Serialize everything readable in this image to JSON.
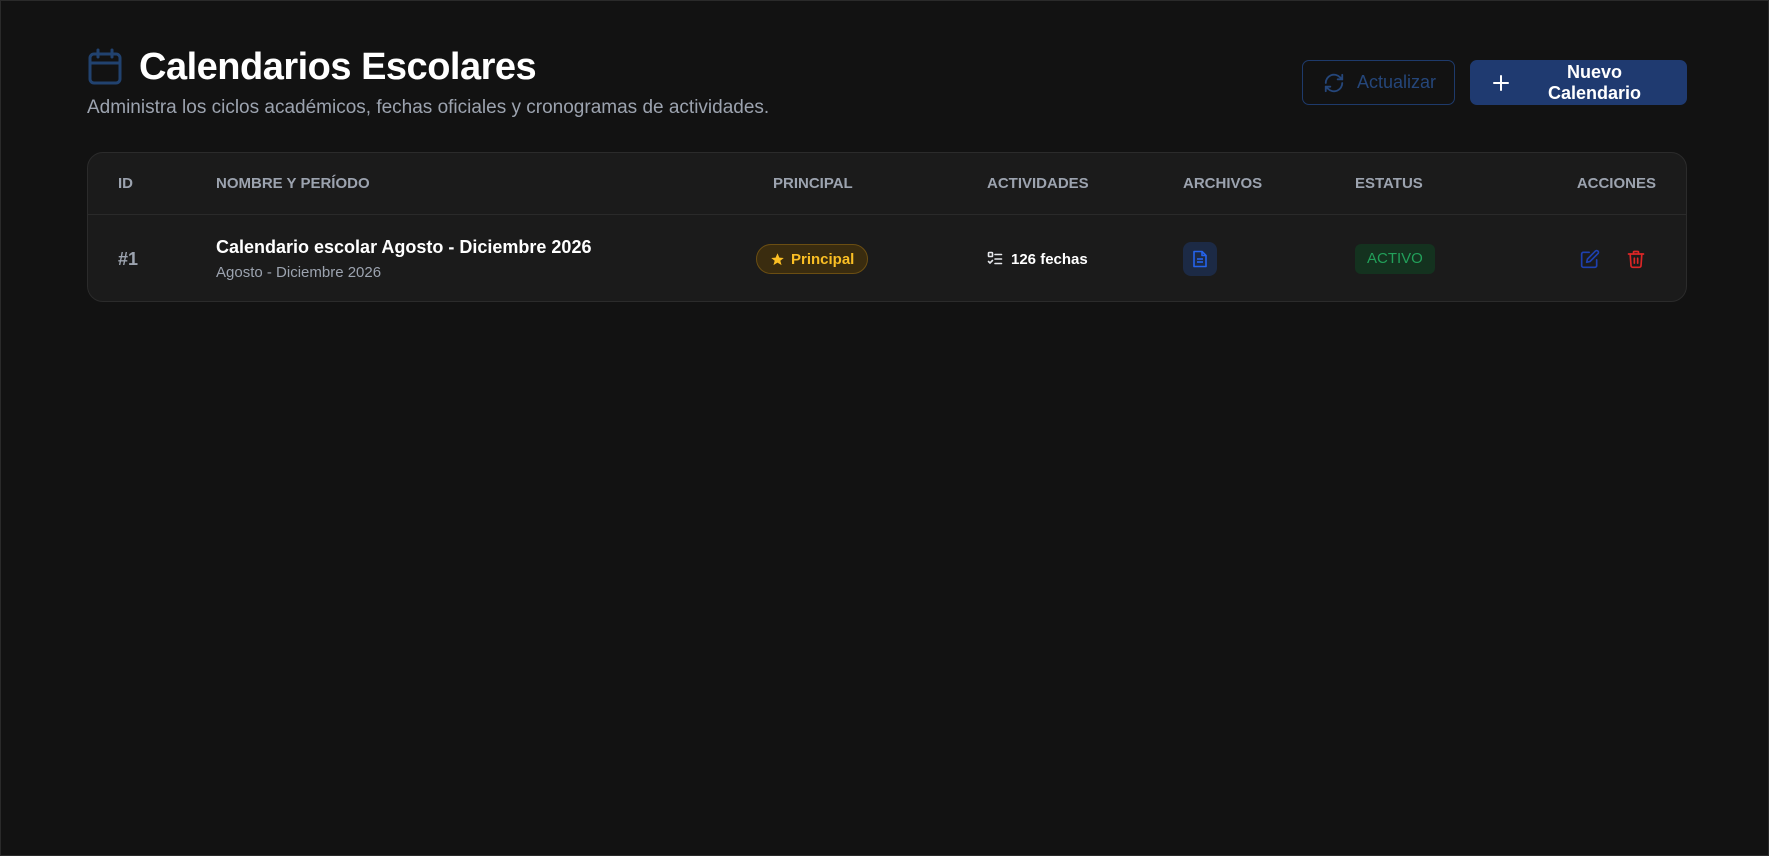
{
  "header": {
    "title": "Calendarios Escolares",
    "subtitle": "Administra los ciclos académicos, fechas oficiales y cronogramas de actividades.",
    "refresh_label": "Actualizar",
    "new_label": "Nuevo Calendario",
    "title_icon": "calendar-icon",
    "refresh_icon": "refresh-icon",
    "new_icon": "plus-icon"
  },
  "table": {
    "columns": {
      "id": "ID",
      "name": "NOMBRE Y PERÍODO",
      "principal": "PRINCIPAL",
      "activities": "ACTIVIDADES",
      "files": "ARCHIVOS",
      "status": "ESTATUS",
      "actions": "ACCIONES"
    },
    "rows": [
      {
        "id": "#1",
        "name": "Calendario escolar Agosto - Diciembre 2026",
        "period": "Agosto - Diciembre 2026",
        "principal_label": "Principal",
        "activities_label": "126 fechas",
        "status": "ACTIVO"
      }
    ]
  },
  "colors": {
    "background": "#121212",
    "card": "#1b1b1b",
    "primary": "#1f3a70",
    "accent_blue": "#2563eb",
    "principal_gold": "#fbbf24",
    "status_green": "#22a05a",
    "danger_red": "#dc2626"
  }
}
